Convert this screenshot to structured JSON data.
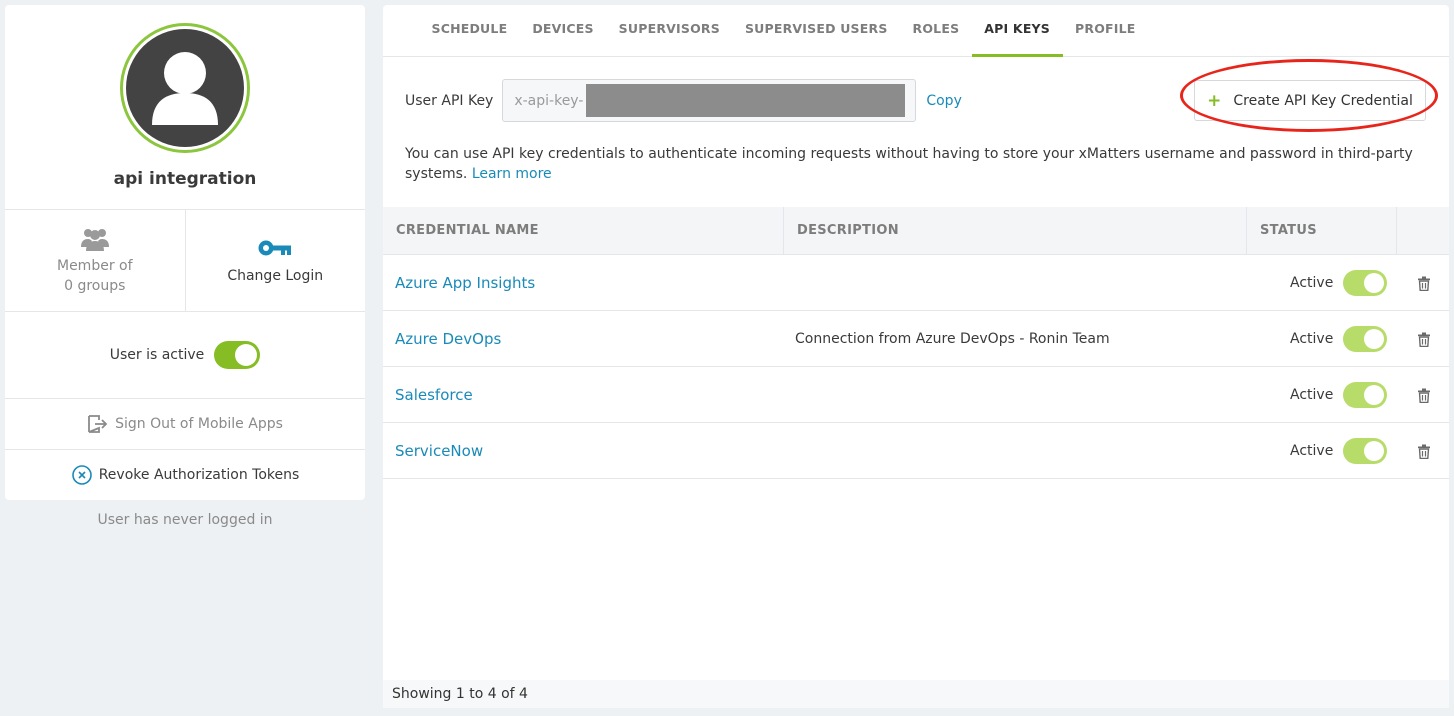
{
  "profile": {
    "name": "api integration",
    "member_of": "Member of",
    "groups": "0 groups",
    "change_login": "Change Login",
    "user_active_label": "User is active",
    "sign_out_label": "Sign Out of Mobile Apps",
    "revoke_label": "Revoke Authorization Tokens",
    "last_login": "User has never logged in"
  },
  "tabs": [
    {
      "label": "SCHEDULE"
    },
    {
      "label": "DEVICES"
    },
    {
      "label": "SUPERVISORS"
    },
    {
      "label": "SUPERVISED USERS"
    },
    {
      "label": "ROLES"
    },
    {
      "label": "API KEYS"
    },
    {
      "label": "PROFILE"
    }
  ],
  "active_tab": "API KEYS",
  "api_key": {
    "label": "User API Key",
    "value_prefix": "x-api-key-",
    "copy_label": "Copy",
    "create_label": "Create API Key Credential",
    "info_text": "You can use API key credentials to authenticate incoming requests without having to store your xMatters username and password in third-party systems.",
    "learn_more": "Learn more"
  },
  "table": {
    "headers": [
      "CREDENTIAL NAME",
      "DESCRIPTION",
      "STATUS"
    ],
    "rows": [
      {
        "name": "Azure App Insights",
        "description": "",
        "status": "Active"
      },
      {
        "name": "Azure DevOps",
        "description": "Connection from Azure DevOps - Ronin Team",
        "status": "Active"
      },
      {
        "name": "Salesforce",
        "description": "",
        "status": "Active"
      },
      {
        "name": "ServiceNow",
        "description": "",
        "status": "Active"
      }
    ],
    "footer": "Showing 1 to 4 of 4"
  },
  "icons": {
    "avatar": "user-silhouette-icon",
    "group": "group-icon",
    "key": "key-icon",
    "sign_out": "sign-out-icon",
    "revoke": "revoke-icon",
    "trash": "trash-icon",
    "plus": "plus-icon"
  },
  "colors": {
    "accent_green": "#86bd25",
    "link_blue": "#1a8ab8",
    "highlight_red": "#e8251a"
  }
}
